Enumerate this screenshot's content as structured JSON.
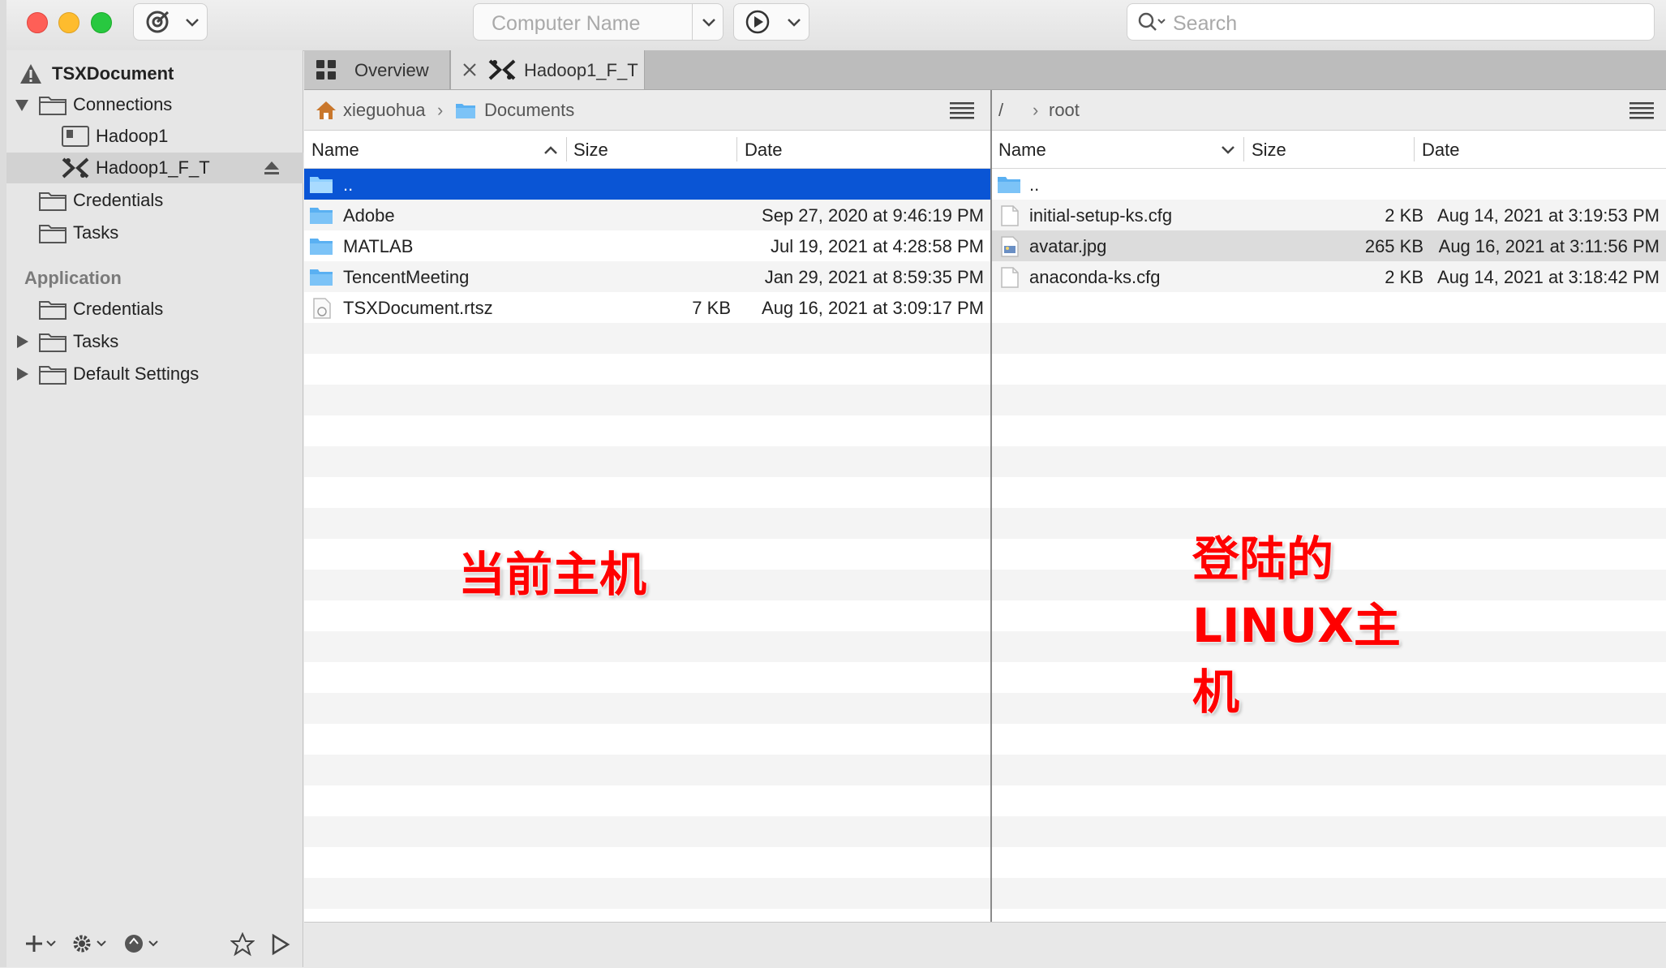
{
  "toolbar": {
    "computer_name_placeholder": "Computer Name",
    "search_placeholder": "Search"
  },
  "sidebar": {
    "document_title": "TSXDocument",
    "connections_label": "Connections",
    "connection_items": [
      "Hadoop1",
      "Hadoop1_F_T"
    ],
    "credentials_label": "Credentials",
    "tasks_label": "Tasks",
    "application_section": "Application",
    "app_credentials_label": "Credentials",
    "app_tasks_label": "Tasks",
    "app_default_settings_label": "Default Settings"
  },
  "tabs": {
    "overview_label": "Overview",
    "session_label": "Hadoop1_F_T"
  },
  "local_pane": {
    "breadcrumb": [
      "xieguohua",
      "Documents"
    ],
    "columns": {
      "name": "Name",
      "size": "Size",
      "date": "Date"
    },
    "files": [
      {
        "name": "..",
        "size": "",
        "date": "",
        "type": "folder"
      },
      {
        "name": "Adobe",
        "size": "",
        "date": "Sep 27, 2020 at 9:46:19 PM",
        "type": "folder"
      },
      {
        "name": "MATLAB",
        "size": "",
        "date": "Jul 19, 2021 at 4:28:58 PM",
        "type": "folder"
      },
      {
        "name": "TencentMeeting",
        "size": "",
        "date": "Jan 29, 2021 at 8:59:35 PM",
        "type": "folder"
      },
      {
        "name": "TSXDocument.rtsz",
        "size": "7 KB",
        "date": "Aug 16, 2021 at 3:09:17 PM",
        "type": "file"
      }
    ]
  },
  "remote_pane": {
    "breadcrumb": [
      "/",
      "root"
    ],
    "columns": {
      "name": "Name",
      "size": "Size",
      "date": "Date"
    },
    "files": [
      {
        "name": "..",
        "size": "",
        "date": "",
        "type": "folder"
      },
      {
        "name": "initial-setup-ks.cfg",
        "size": "2 KB",
        "date": "Aug 14, 2021 at 3:19:53 PM",
        "type": "file"
      },
      {
        "name": "avatar.jpg",
        "size": "265 KB",
        "date": "Aug 16, 2021 at 3:11:56 PM",
        "type": "image"
      },
      {
        "name": "anaconda-ks.cfg",
        "size": "2 KB",
        "date": "Aug 14, 2021 at 3:18:42 PM",
        "type": "file"
      }
    ]
  },
  "annotations": {
    "local_note": "当前主机",
    "remote_note_lines": [
      "登陆的",
      "LINUX主",
      "机"
    ]
  },
  "colors": {
    "selection": "#0a55d5",
    "annotation": "#ff0000",
    "folder": "#5ab0f2"
  }
}
